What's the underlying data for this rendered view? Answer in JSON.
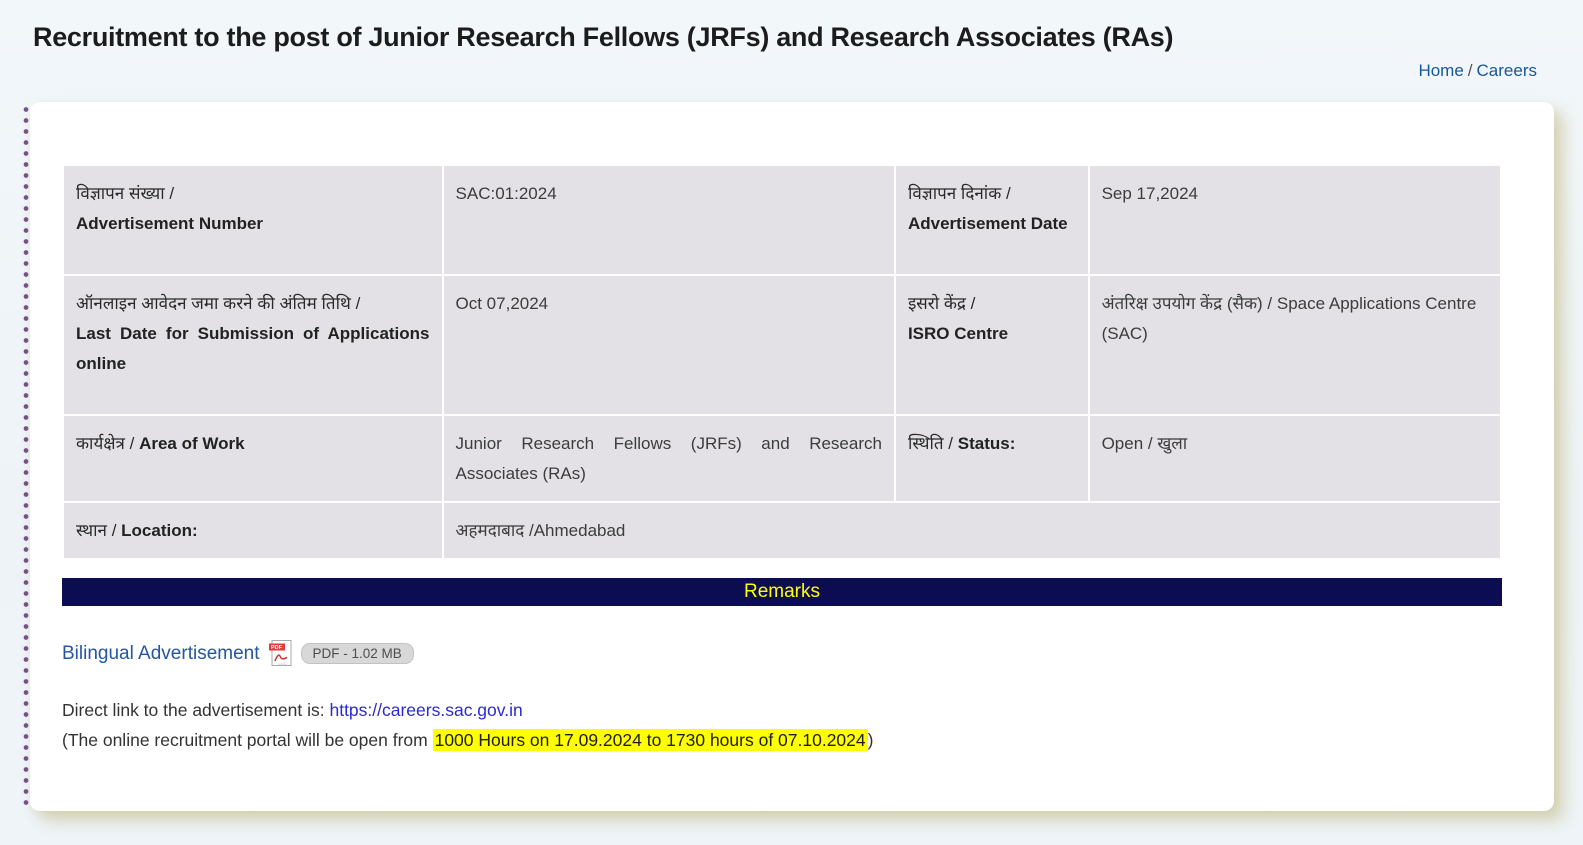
{
  "header": {
    "title": "Recruitment to the post of Junior Research Fellows (JRFs) and Research Associates (RAs)",
    "breadcrumb": {
      "home": "Home",
      "separator": "/",
      "current": "Careers"
    }
  },
  "table": {
    "rows": [
      {
        "c1_hi": "विज्ञापन संख्या /",
        "c1_en": "Advertisement Number",
        "c2": "SAC:01:2024",
        "c3_hi": "विज्ञापन दिनांक /",
        "c3_en": "Advertisement Date",
        "c4": "Sep 17,2024"
      },
      {
        "c1_hi": "ऑनलाइन आवेदन जमा करने की अंतिम तिथि /",
        "c1_en": "Last Date for Submission of Applications online",
        "c2": "Oct 07,2024",
        "c3_hi": "इसरो केंद्र /",
        "c3_en": "ISRO Centre",
        "c4": "अंतरिक्ष उपयोग केंद्र (सैक) / Space Applications Centre (SAC)"
      },
      {
        "c1_hi": "कार्यक्षेत्र / ",
        "c1_en": "Area of Work",
        "c2": "Junior Research Fellows (JRFs) and Research Associates (RAs)",
        "c3_hi": "स्थिति / ",
        "c3_en": "Status:",
        "c4": "Open / खुला"
      },
      {
        "c1_hi": "स्थान / ",
        "c1_en": "Location:",
        "c2": "अहमदाबाद /Ahmedabad"
      }
    ]
  },
  "remarks": {
    "label": "Remarks"
  },
  "attachment": {
    "link_label": "Bilingual Advertisement",
    "icon": "pdf-icon",
    "badge": "PDF - 1.02 MB"
  },
  "direct": {
    "prefix": "Direct link to the advertisement is: ",
    "url": "https://careers.sac.gov.in"
  },
  "portal": {
    "prefix": "(The online recruitment portal will be open from ",
    "highlight": "1000 Hours on 17.09.2024 to 1730 hours of 07.10.2024",
    "suffix": ")"
  },
  "colors": {
    "remarks_bg": "#0c0c52",
    "remarks_text": "#ffff00",
    "highlight": "#ffff00",
    "breadcrumb_blue": "#14589d",
    "attachment_link_blue": "#2456a4",
    "url_link_blue": "#2a2ad4",
    "cell_bg": "#e3e1e5",
    "dot_purple": "#7b4f85"
  }
}
